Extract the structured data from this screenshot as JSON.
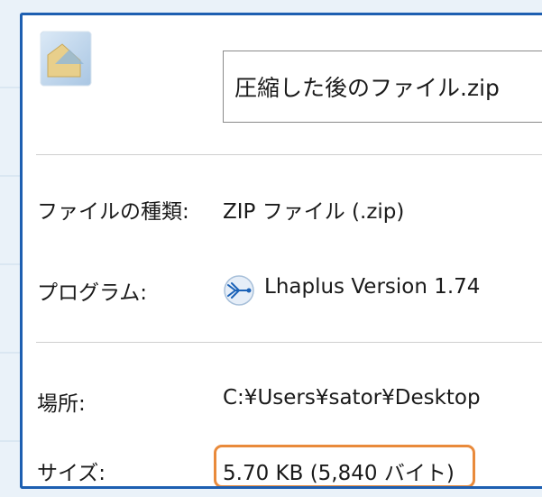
{
  "file_name": "圧縮した後のファイル.zip",
  "file_type": {
    "label": "ファイルの種類:",
    "value": "ZIP ファイル (.zip)"
  },
  "program": {
    "label": "プログラム:",
    "value": "Lhaplus Version 1.74"
  },
  "location": {
    "label": "場所:",
    "value": "C:¥Users¥sator¥Desktop"
  },
  "size": {
    "label": "サイズ:",
    "value": "5.70 KB (5,840 バイト)"
  },
  "colors": {
    "frame": "#1d5fb1",
    "highlight": "#e98a3b",
    "separator": "#cfcfcf"
  },
  "icons": {
    "file": "zip-folder-icon",
    "program": "lhaplus-icon"
  }
}
